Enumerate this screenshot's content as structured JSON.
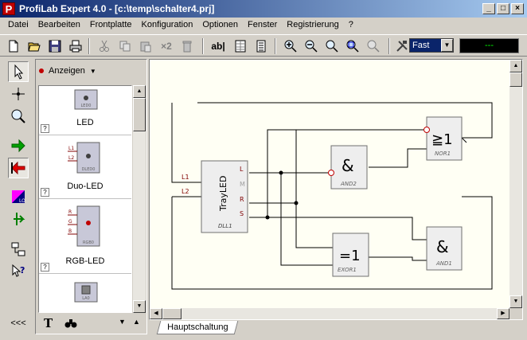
{
  "window": {
    "icon_letter": "P",
    "title": "ProfiLab Expert 4.0 - [c:\\temp\\schalter4.prj]",
    "min_glyph": "_",
    "max_glyph": "□",
    "close_glyph": "×"
  },
  "menu": [
    "Datei",
    "Bearbeiten",
    "Frontplatte",
    "Konfiguration",
    "Optionen",
    "Fenster",
    "Registrierung",
    "?"
  ],
  "toolbar": {
    "text_tool_label": "ab|",
    "multiply_label": "×2",
    "speed_value": "Fast",
    "display_value": "---"
  },
  "left_tools": {
    "bottom_label": "<<<"
  },
  "library": {
    "category": "Anzeigen",
    "items": [
      {
        "label": "LED",
        "tag": "LED0"
      },
      {
        "label": "Duo-LED",
        "tag": "DLED0",
        "pins": [
          "L1",
          "L2"
        ]
      },
      {
        "label": "RGB-LED",
        "tag": "RGB0",
        "pins": [
          "R",
          "G",
          "B"
        ]
      },
      {
        "label": "",
        "tag": "LA0"
      }
    ],
    "help_glyph": "?",
    "footer_text_icon": "T"
  },
  "circuit": {
    "components": [
      {
        "name": "TrayLED",
        "tag": "DLL1",
        "inputs": [
          "L1",
          "L2"
        ],
        "outputs": [
          "L",
          "M",
          "R",
          "S"
        ]
      },
      {
        "name": "&",
        "tag": "AND2"
      },
      {
        "name": "≧1",
        "tag": "NOR1"
      },
      {
        "name": "=1",
        "tag": "EXOR1"
      },
      {
        "name": "&",
        "tag": "AND1"
      }
    ]
  },
  "tabs": [
    {
      "label": "Hauptschaltung"
    }
  ],
  "colors": {
    "title_start": "#0a246a",
    "title_end": "#a6caf0",
    "canvas_bg": "#fffff4",
    "wire": "#000000",
    "pin_label": "#800000"
  }
}
